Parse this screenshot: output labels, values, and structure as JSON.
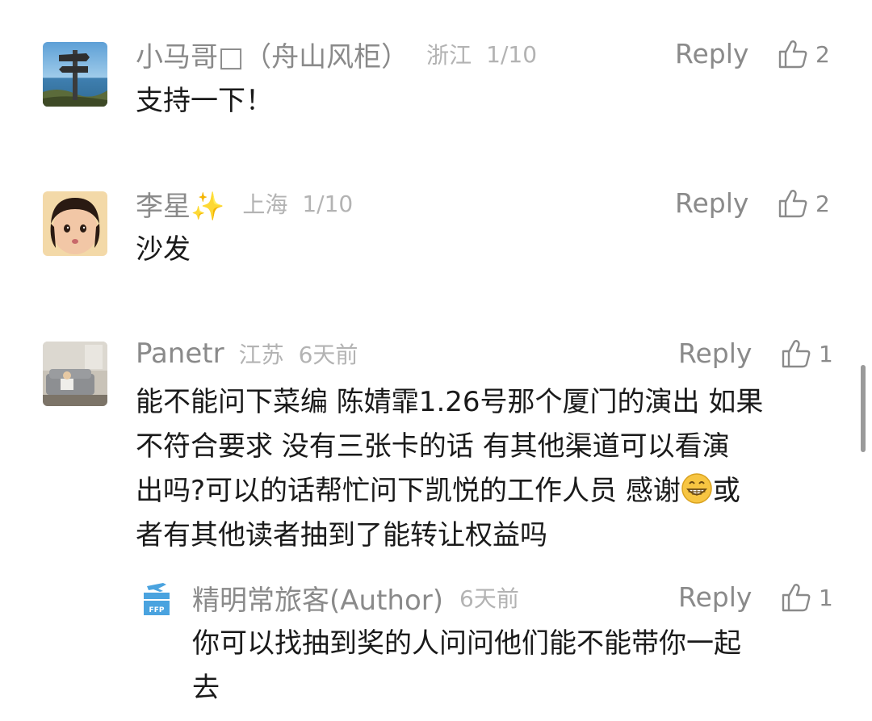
{
  "comments": [
    {
      "avatar_icon": "seaside-signpost-avatar",
      "nickname": "小马哥□（舟山风柜）",
      "location": "浙江",
      "date": "1/10",
      "reply_label": "Reply",
      "likes": "2",
      "text": "支持一下！"
    },
    {
      "avatar_icon": "toddler-photo-avatar",
      "nickname": "李星✨",
      "location": "上海",
      "date": "1/10",
      "reply_label": "Reply",
      "likes": "2",
      "text": "沙发"
    },
    {
      "avatar_icon": "living-room-photo-avatar",
      "nickname": "Panetr",
      "location": "江苏",
      "date": "6天前",
      "reply_label": "Reply",
      "likes": "1",
      "text_line1": "能不能问下菜编 陈婧霏1.26号那个厦门的演出 如果",
      "text_line2": "不符合要求 没有三张卡的话 有其他渠道可以看演",
      "text_line3a": "出吗?可以的话帮忙问下凯悦的工作人员 感谢",
      "text_line3_emoji": "grinning-face-emoji",
      "text_line3b": "或",
      "text_line4": "者有其他读者抽到了能转让权益吗",
      "reply": {
        "avatar_icon": "ffp-airplane-logo-avatar",
        "avatar_label": "FFP",
        "nickname": "精明常旅客(Author)",
        "date": "6天前",
        "reply_label": "Reply",
        "likes": "1",
        "text_line1": "你可以找抽到奖的人问问他们能不能带你一起",
        "text_line2": "去"
      }
    }
  ],
  "icons": {
    "like": "thumbs-up-icon"
  },
  "colors": {
    "meta_gray": "#8a8a8a",
    "light_gray": "#b3b3b3",
    "text": "#1a1a1a",
    "ffp_blue": "#4aa3df"
  }
}
